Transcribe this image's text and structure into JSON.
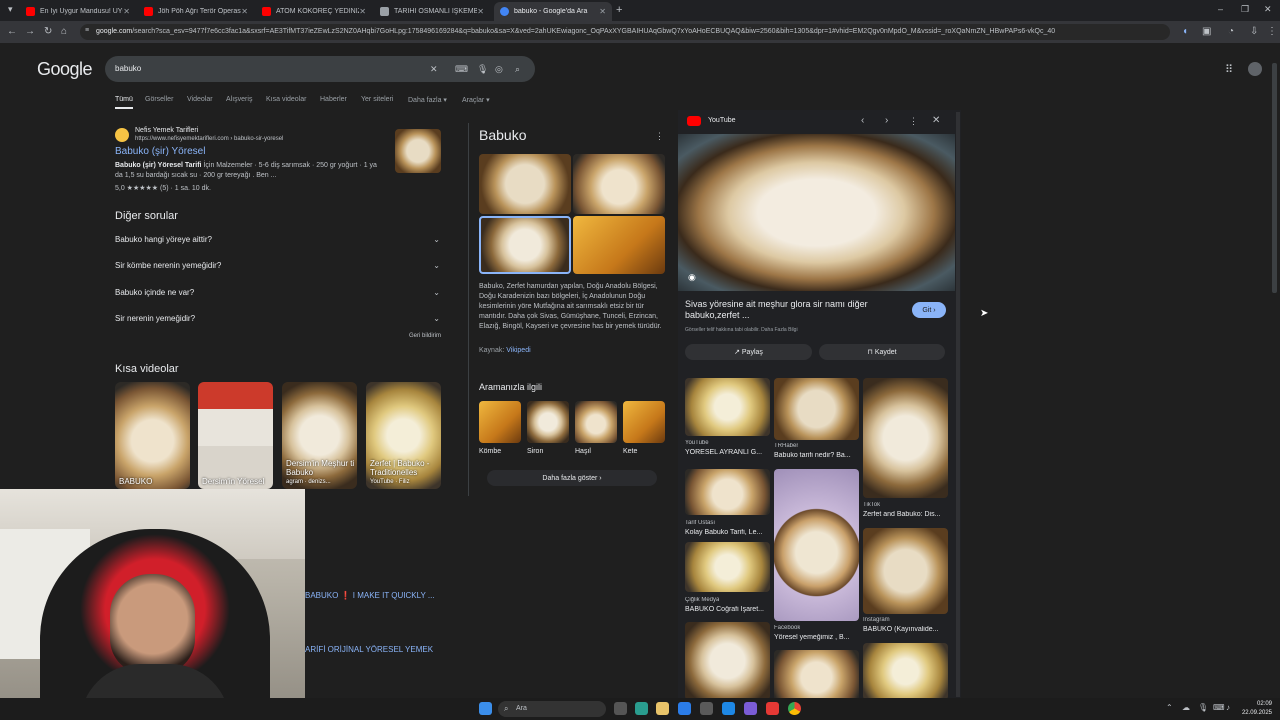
{
  "tabs": [
    {
      "title": "En İyi Uygur Mandusu! UYGUR",
      "favicon_color": "#ff0000"
    },
    {
      "title": "Jöh Pöh Ağrı Terör Operasyonu",
      "favicon_color": "#ff0000"
    },
    {
      "title": "ATOM KOKOREÇ YEDİNİZ Mİ?",
      "favicon_color": "#ff0000"
    },
    {
      "title": "TARİHİ OSMANLI İŞKEMBE KEL",
      "favicon_color": "#9aa0a6"
    },
    {
      "title": "babuko - Google'da Ara",
      "favicon_color": "#4285f4",
      "active": true
    }
  ],
  "new_tab": "+",
  "window_controls": {
    "minimize": "–",
    "maximize": "❐",
    "close": "✕"
  },
  "address": {
    "domain": "google.com",
    "path": "/search?sca_esv=9477f7e6cc3fac1a&sxsrf=AE3TifMT37ieZEwLzS2NZ0AHqbi7GoHLpg:1758496169284&q=babuko&sa=X&ved=2ahUKEwiagonc_OqPAxXYGBAIHUAqGbwQ7xYoAHoECBUQAQ&biw=2560&bih=1305&dpr=1#vhid=EM2Qgv0nMpdO_M&vssid=_roXQaNmZN_HBwPAPs6-vkQc_40"
  },
  "logo": "Google",
  "search": {
    "query": "babuko"
  },
  "nav_tabs": [
    "Tümü",
    "Görseller",
    "Videolar",
    "Alışveriş",
    "Kısa videolar",
    "Haberler",
    "Yer siteleri",
    "Daha fazla ▾",
    "Araçlar ▾"
  ],
  "result": {
    "site_name": "Nefis Yemek Tarifleri",
    "site_url": "https://www.nefisyemektarifleri.com › babuko-sir-yoresel",
    "title": "Babuko (şir) Yöresel",
    "snippet_bold": "Babuko (şir) Yöresel Tarifi",
    "snippet": " İçin Malzemeler · 5-6 diş sarımsak · 250 gr yoğurt · 1 ya da 1,5 su bardağı sıcak su · 200 gr tereyağı . Ben ...",
    "rating": "5,0 ★★★★★ (5) · 1 sa. 10 dk."
  },
  "faq": {
    "title": "Diğer sorular",
    "items": [
      "Babuko hangi yöreye aittir?",
      "Sir kömbe nerenin yemeğidir?",
      "Babuko içinde ne var?",
      "Sir nerenin yemeğidir?"
    ],
    "feedback": "Geri bildirim"
  },
  "shorts": {
    "title": "Kısa videolar",
    "items": [
      {
        "title": "BABUKO",
        "source": ""
      },
      {
        "title": "Dersim'in Yöresel",
        "source": ""
      },
      {
        "title": "Dersim'in Meşhur ti Babuko",
        "source": "agram · denizs..."
      },
      {
        "title": "Zerfet | Babuko - Traditionelles",
        "source": "YouTube · Filiz"
      }
    ]
  },
  "video_results": [
    "BABUKO ❗ I MAKE IT QUICKLY ...",
    "ARİFİ ORİJİNAL YÖRESEL YEMEK"
  ],
  "knowledge": {
    "title": "Babuko",
    "description": "Babuko, Zerfet hamurdan yapılan, Doğu Anadolu Bölgesi, Doğu Karadenizin bazı bölgeleri, İç Anadolunun Doğu kesimlerinin yöre Mutfağına ait sarımsaklı etsiz bir tür mantıdır. Daha çok Sivas, Gümüşhane, Tunceli, Erzincan, Elazığ, Bingöl, Kayseri ve çevresine has bir yemek türüdür.",
    "source_label": "Kaynak:",
    "source_link": "Vikipedi",
    "related_title": "Aramanızla ilgili",
    "related": [
      "Kömbe",
      "Siron",
      "Haşıl",
      "Kete"
    ],
    "more": "Daha fazla göster"
  },
  "preview": {
    "source": "YouTube",
    "title": "Sivas yöresine ait meşhur glora sir namı diğer babuko,zerfet ...",
    "visit": "Git",
    "notice": "Görseller telif hakkına tabi olabilir. Daha Fazla Bilgi",
    "share": "Paylaş",
    "save": "Kaydet",
    "grid": [
      {
        "source": "YouTube",
        "title": "YÖRESEL AYRANLI G..."
      },
      {
        "source": "TRHaber",
        "title": "Babuko tarifi nedir? Ba..."
      },
      {
        "source": "TikTok",
        "title": "Zerfet and Babuko: Dis..."
      },
      {
        "source": "Tarif Ustası",
        "title": "Kolay Babuko Tarifi, Le..."
      },
      {
        "source": "Çiğlik Medya",
        "title": "BABUKO Coğrafi İşaret..."
      },
      {
        "source": "Facebook",
        "title": "Yöresel yemeğimiz , B..."
      },
      {
        "source": "Instagram",
        "title": "BABUKO (Kayınvalide..."
      }
    ]
  },
  "taskbar": {
    "search_placeholder": "Ara",
    "time": "02:09",
    "date": "22.09.2025"
  }
}
